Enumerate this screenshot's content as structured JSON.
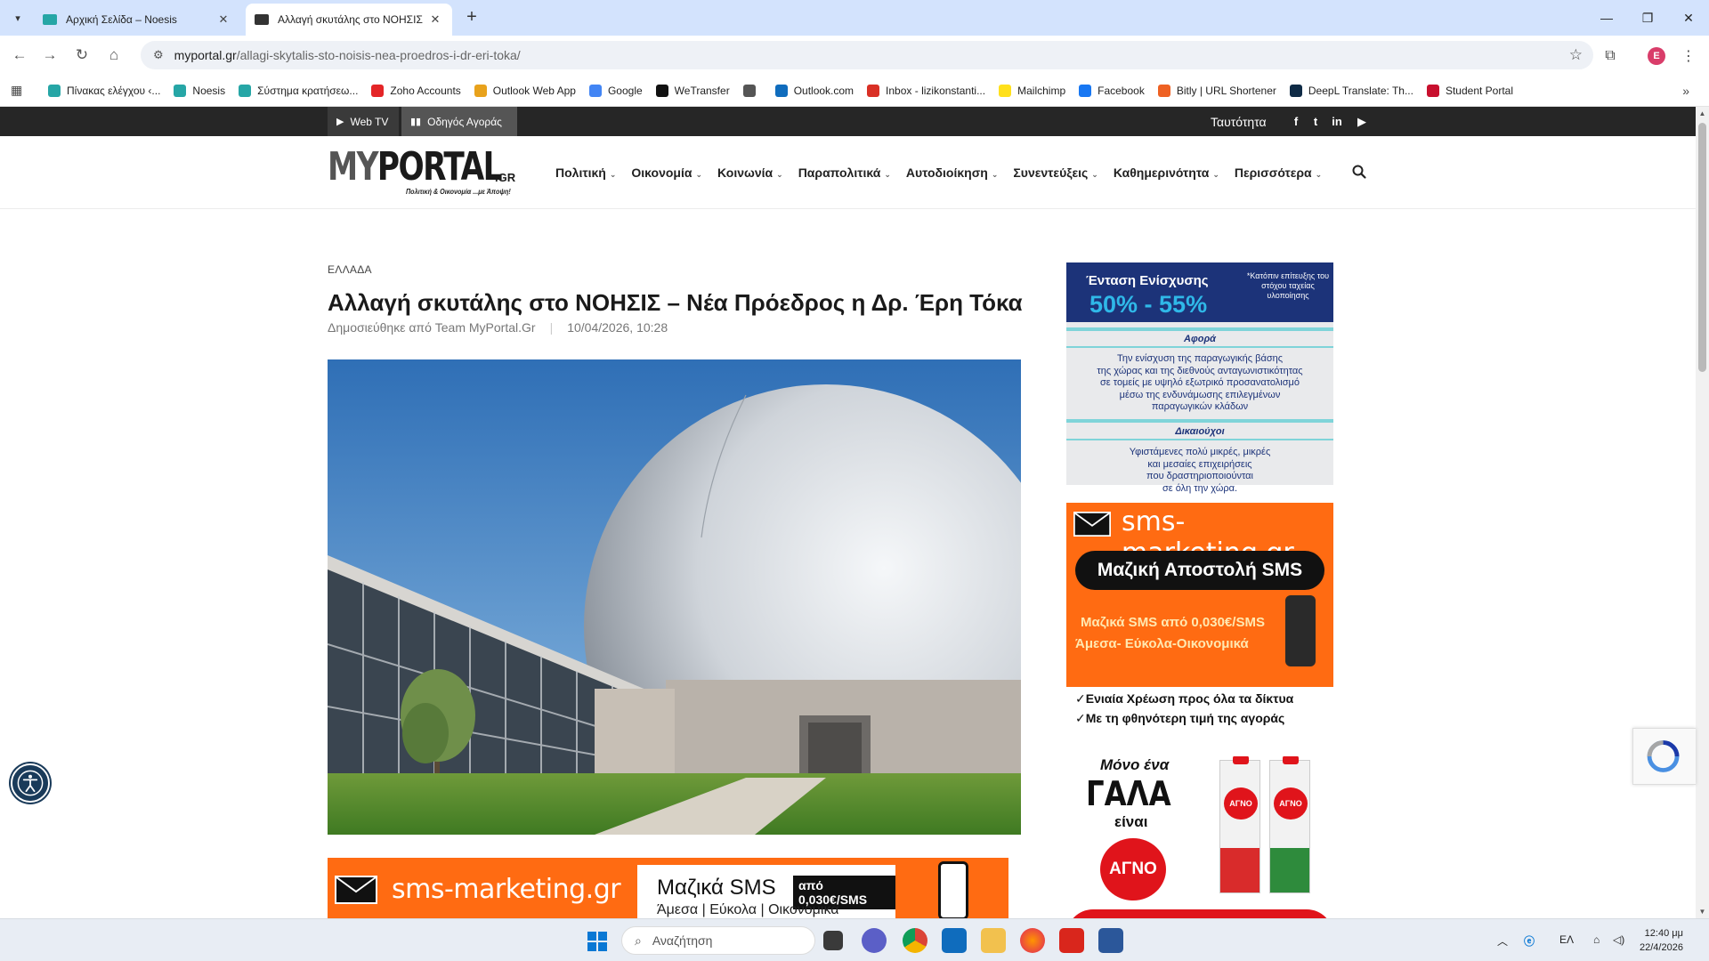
{
  "browser": {
    "tabs": [
      {
        "title": "Αρχική Σελίδα – Noesis",
        "active": false
      },
      {
        "title": "Αλλαγή σκυτάλης στο ΝΟΗΣΙΣ",
        "active": true
      }
    ],
    "url_host": "myportal.gr",
    "url_path": "/allagi-skytalis-sto-noisis-nea-proedros-i-dr-eri-toka/",
    "profile_initial": "E",
    "bookmarks": [
      {
        "label": "Πίνακας ελέγχου ‹...",
        "color": "#26a6a6"
      },
      {
        "label": "Noesis",
        "color": "#26a6a6"
      },
      {
        "label": "Σύστημα κρατήσεω...",
        "color": "#26a6a6"
      },
      {
        "label": "Zoho Accounts",
        "color": "#e42527"
      },
      {
        "label": "Outlook Web App",
        "color": "#e8a21c"
      },
      {
        "label": "Google",
        "color": "#4285f4"
      },
      {
        "label": "WeTransfer",
        "color": "#111111"
      },
      {
        "label": "",
        "color": "#555555"
      },
      {
        "label": "Outlook.com",
        "color": "#0f6cbd"
      },
      {
        "label": "Inbox - lizikonstanti...",
        "color": "#d93025"
      },
      {
        "label": "Mailchimp",
        "color": "#ffe01b"
      },
      {
        "label": "Facebook",
        "color": "#1877f2"
      },
      {
        "label": "Bitly | URL Shortener",
        "color": "#ee6123"
      },
      {
        "label": "DeepL Translate: Th...",
        "color": "#0f2b46"
      },
      {
        "label": "Student Portal",
        "color": "#c8102e"
      }
    ]
  },
  "site": {
    "topbar": {
      "web_tv": "Web TV",
      "guide": "Οδηγός Αγοράς",
      "identity": "Ταυτότητα"
    },
    "logo": {
      "main_a": "MY",
      "main_b": "PORTAL",
      "gr": ".GR",
      "tagline": "Πολιτική & Οικονομία ...με Άποψη!"
    },
    "nav": [
      {
        "label": "Πολιτική"
      },
      {
        "label": "Οικονομία"
      },
      {
        "label": "Κοινωνία"
      },
      {
        "label": "Παραπολιτικά"
      },
      {
        "label": "Αυτοδιοίκηση"
      },
      {
        "label": "Συνεντεύξεις"
      },
      {
        "label": "Καθημερινότητα"
      },
      {
        "label": "Περισσότερα"
      }
    ]
  },
  "article": {
    "category": "ΕΛΛΑΔΑ",
    "title": "Αλλαγή σκυτάλης στο ΝΟΗΣΙΣ – Νέα Πρόεδρος η Δρ. Έρη Τόκα",
    "author": "Δημοσιεύθηκε από Team MyPortal.Gr",
    "date": "10/04/2026, 10:28"
  },
  "ads": {
    "bottom": {
      "brand": "sms-marketing.gr",
      "line1": "Μαζικά SMS",
      "tag": "από 0,030€/SMS",
      "line2": "Άμεσα | Εύκολα | Οικονομικά"
    },
    "ad1": {
      "h1": "Ένταση Ενίσχυσης",
      "h2": "50% - 55%",
      "h3": "*Κατόπιν επίτευξης του στόχου ταχείας υλοποίησης",
      "sec1": "Αφορά",
      "body1": [
        "Την ενίσχυση της παραγωγικής βάσης",
        "της χώρας και της διεθνούς ανταγωνιστικότητας",
        "σε τομείς με υψηλό εξωτρικό προσανατολισμό",
        "μέσω της ενδυνάμωσης επιλεγμένων",
        "παραγωγικών κλάδων"
      ],
      "sec2": "Δικαιούχοι",
      "body2": [
        "Υφιστάμενες πολύ μικρές, μικρές",
        "και μεσαίες επιχειρήσεις",
        "που δραστηριοποιούνται",
        "σε όλη την χώρα."
      ]
    },
    "ad2": {
      "brand": "sms-marketing.gr",
      "pill": "Μαζική Αποστολή SMS",
      "p1": "Μαζικά SMS από 0,030€/SMS",
      "p2": "Άμεσα- Εύκολα-Οικονομικά",
      "chk1": "✓Ενιαία Χρέωση προς όλα τα δίκτυα",
      "chk2": "✓Με τη φθηνότερη τιμή της αγοράς"
    },
    "ad3": {
      "m1": "Μόνο ένα",
      "m2": "ΓΑΛΑ",
      "m3": "είναι",
      "brand": "ΑΓΝΟ",
      "carton_label": "ΑΓΝΟ"
    }
  },
  "taskbar": {
    "search_placeholder": "Αναζήτηση",
    "lang": "ΕΛ",
    "time": "12:40 μμ",
    "date": "22/4/2026"
  },
  "colors": {
    "accent_orange": "#ff6b12",
    "navy": "#1c3379",
    "topbar": "#262626"
  }
}
